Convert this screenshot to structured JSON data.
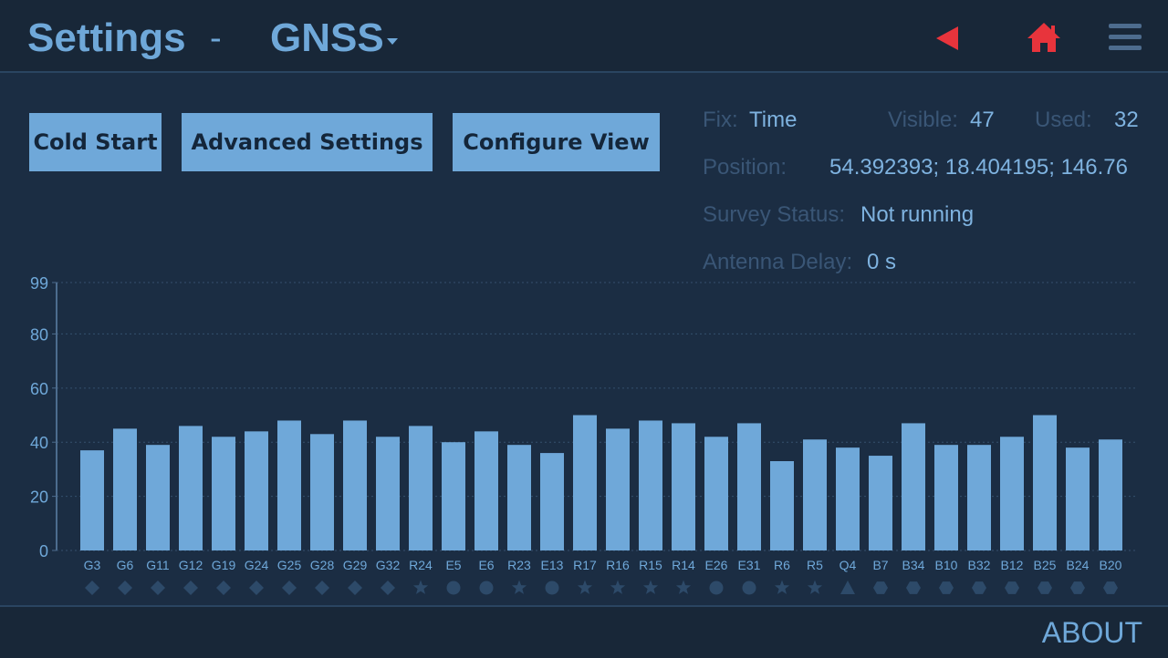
{
  "header": {
    "title": "Settings",
    "separator": "-",
    "section": "GNSS",
    "icons": {
      "back": "back-triangle-icon",
      "home": "home-icon",
      "menu": "hamburger-menu-icon"
    },
    "accent_color": "#e8343c"
  },
  "buttons": {
    "cold_start": "Cold Start",
    "advanced_settings": "Advanced Settings",
    "configure_view": "Configure View"
  },
  "status": {
    "fix_label": "Fix:",
    "fix_value": "Time",
    "visible_label": "Visible:",
    "visible_value": "47",
    "used_label": "Used:",
    "used_value": "32",
    "position_label": "Position:",
    "position_value": "54.392393; 18.404195; 146.76",
    "survey_label": "Survey Status:",
    "survey_value": "Not running",
    "antenna_label": "Antenna Delay:",
    "antenna_value": "0 s"
  },
  "chart_data": {
    "type": "bar",
    "categories": [
      "G3",
      "G6",
      "G11",
      "G12",
      "G19",
      "G24",
      "G25",
      "G28",
      "G29",
      "G32",
      "R24",
      "E5",
      "E6",
      "R23",
      "E13",
      "R17",
      "R16",
      "R15",
      "R14",
      "E26",
      "E31",
      "R6",
      "R5",
      "Q4",
      "B7",
      "B34",
      "B10",
      "B32",
      "B12",
      "B25",
      "B24",
      "B20"
    ],
    "values": [
      37,
      45,
      39,
      46,
      42,
      44,
      48,
      43,
      48,
      42,
      46,
      40,
      44,
      39,
      36,
      50,
      45,
      48,
      47,
      42,
      47,
      33,
      41,
      38,
      35,
      47,
      39,
      39,
      42,
      50,
      38,
      41
    ],
    "constellation_markers": [
      "diamond",
      "diamond",
      "diamond",
      "diamond",
      "diamond",
      "diamond",
      "diamond",
      "diamond",
      "diamond",
      "diamond",
      "star",
      "circle",
      "circle",
      "star",
      "circle",
      "star",
      "star",
      "star",
      "star",
      "circle",
      "circle",
      "star",
      "star",
      "triangle",
      "hexagon",
      "hexagon",
      "hexagon",
      "hexagon",
      "hexagon",
      "hexagon",
      "hexagon",
      "hexagon"
    ],
    "yticks": [
      0,
      20,
      40,
      60,
      80,
      99
    ],
    "ylim": [
      0,
      99
    ],
    "grid": true,
    "bar_color": "#6fa8d9"
  },
  "footer": {
    "about": "ABOUT"
  }
}
